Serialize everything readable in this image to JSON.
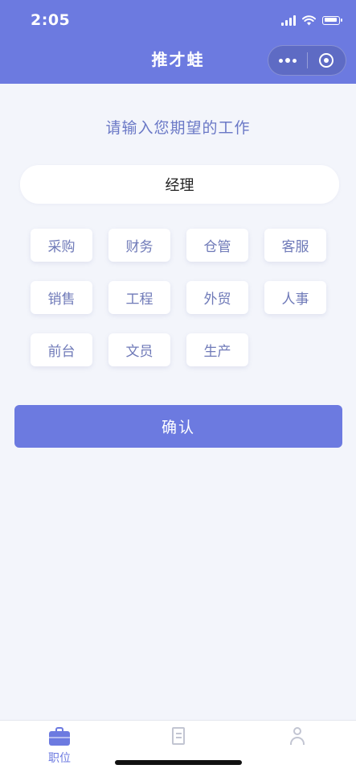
{
  "status_bar": {
    "time": "2:05"
  },
  "nav": {
    "title": "推才蛙"
  },
  "main": {
    "prompt": "请输入您期望的工作",
    "job_input": {
      "value": "经理",
      "placeholder": ""
    },
    "tags": [
      {
        "label": "采购"
      },
      {
        "label": "财务"
      },
      {
        "label": "仓管"
      },
      {
        "label": "客服"
      },
      {
        "label": "销售"
      },
      {
        "label": "工程"
      },
      {
        "label": "外贸"
      },
      {
        "label": "人事"
      },
      {
        "label": "前台"
      },
      {
        "label": "文员"
      },
      {
        "label": "生产"
      }
    ],
    "confirm_label": "确认"
  },
  "tabbar": {
    "items": [
      {
        "label": "职位",
        "icon": "briefcase-icon",
        "active": true
      },
      {
        "label": "",
        "icon": "document-icon",
        "active": false
      },
      {
        "label": "",
        "icon": "user-icon",
        "active": false
      }
    ]
  },
  "colors": {
    "primary": "#6c7ae0",
    "background": "#f3f5fb",
    "tag_text": "#6f7ab8",
    "prompt_text": "#6a78c6",
    "inactive_tab": "#b9bccb"
  }
}
